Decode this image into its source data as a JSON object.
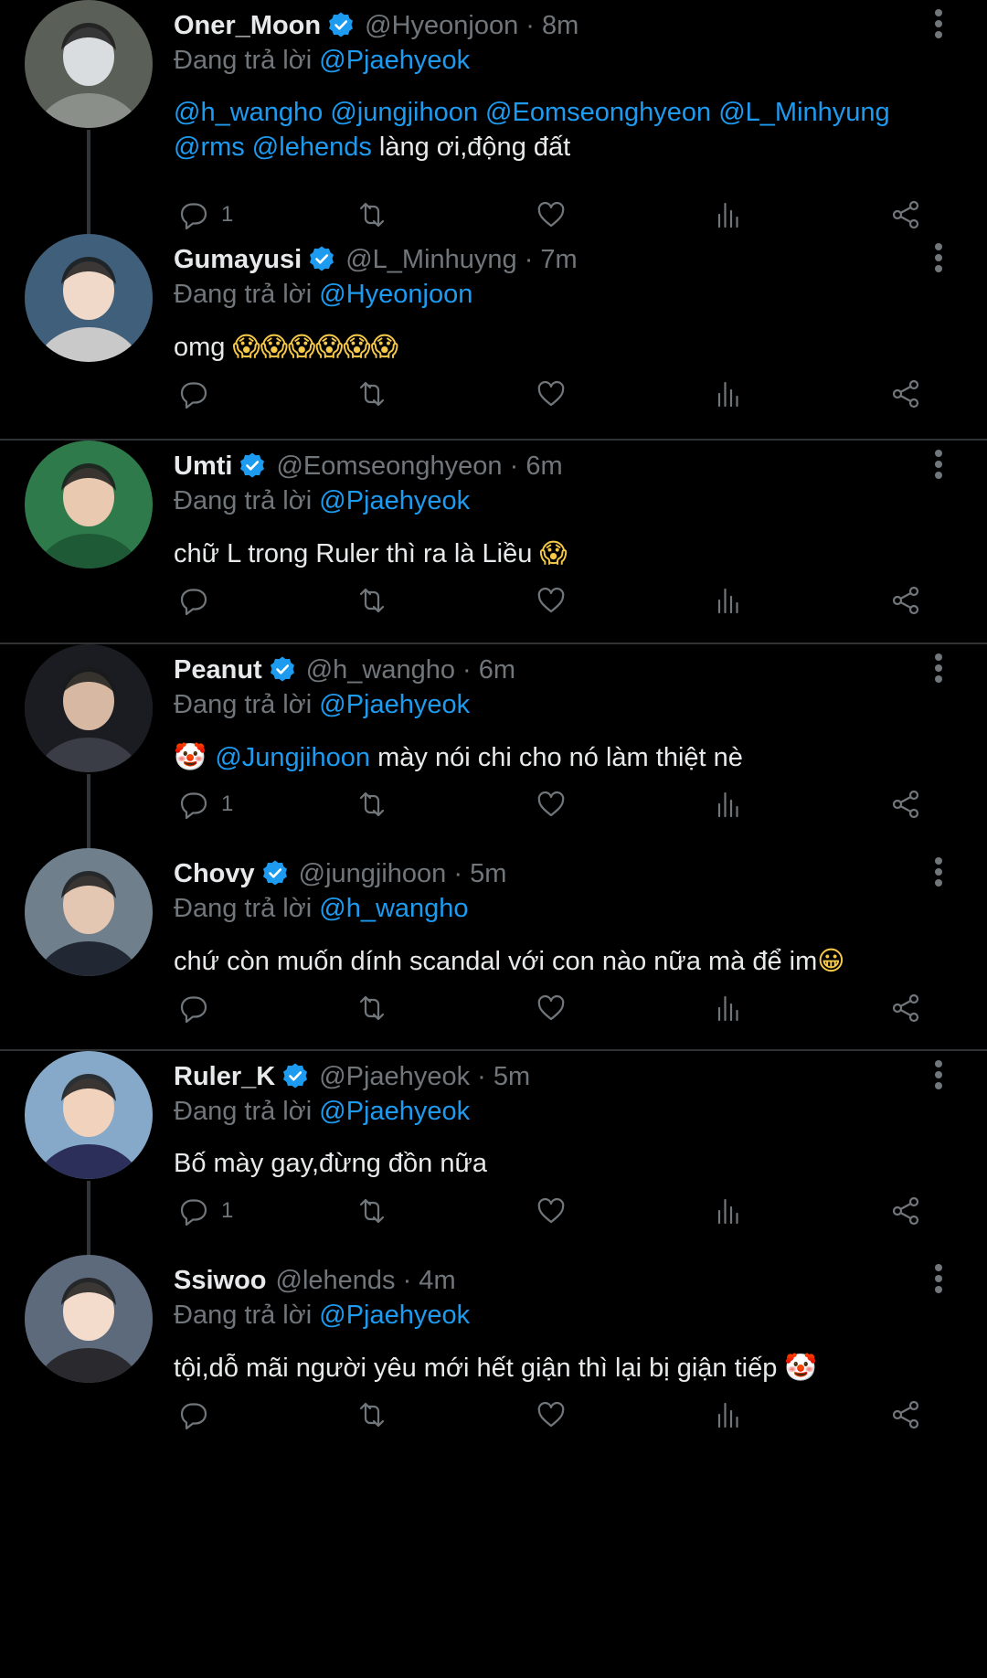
{
  "reply_prefix": "Đang trả lời",
  "colors": {
    "background": "#000000",
    "link": "#1d9bf0",
    "muted": "#71767b",
    "verified": "#1d9bf0"
  },
  "icons": {
    "reply": "comment-bubble-icon",
    "retweet": "retweet-icon",
    "like": "heart-icon",
    "views": "analytics-bars-icon",
    "share": "share-icon",
    "more": "more-vertical-icon",
    "verified": "verified-badge-icon"
  },
  "tweets": [
    {
      "name": "Oner_Moon",
      "verified": true,
      "handle_time": "@Hyeonjoon · 8m",
      "reply_to": "@Pjaehyeok",
      "text": [
        {
          "t": "@h_wangho @jungjihoon  @Eomseonghyeon @L_Minhyung @rms @lehends",
          "m": true
        },
        {
          "t": " làng ơi,động đất",
          "m": false
        }
      ],
      "reply_count": "1"
    },
    {
      "name": "Gumayusi",
      "verified": true,
      "handle_time": "@L_Minhuyng · 7m",
      "reply_to": "@Hyeonjoon",
      "text": [
        {
          "t": "omg ",
          "m": false
        },
        {
          "t": "😱😱😱😱😱😱",
          "m": false,
          "e": true
        }
      ],
      "reply_count": ""
    },
    {
      "name": "Umti",
      "verified": true,
      "handle_time": "@Eomseonghyeon · 6m",
      "reply_to": "@Pjaehyeok",
      "text": [
        {
          "t": "chữ L trong Ruler thì ra là Liều ",
          "m": false
        },
        {
          "t": "😱",
          "m": false,
          "e": true
        }
      ],
      "reply_count": ""
    },
    {
      "name": "Peanut",
      "verified": true,
      "handle_time": "@h_wangho · 6m",
      "reply_to": "@Pjaehyeok",
      "text": [
        {
          "t": "🤡 ",
          "m": false,
          "e": true
        },
        {
          "t": "@Jungjihoon",
          "m": true
        },
        {
          "t": " mày nói chi cho nó làm thiệt nè",
          "m": false
        }
      ],
      "reply_count": "1"
    },
    {
      "name": "Chovy",
      "verified": true,
      "handle_time": "@jungjihoon · 5m",
      "reply_to": "@h_wangho",
      "text": [
        {
          "t": "chứ còn muốn dính scandal với con nào nữa mà để im",
          "m": false
        },
        {
          "t": "😀",
          "m": false,
          "e": true
        }
      ],
      "reply_count": ""
    },
    {
      "name": "Ruler_K",
      "verified": true,
      "handle_time": "@Pjaehyeok · 5m",
      "reply_to": "@Pjaehyeok",
      "text": [
        {
          "t": "Bố mày gay,đừng đồn nữa",
          "m": false
        }
      ],
      "reply_count": "1"
    },
    {
      "name": "Ssiwoo",
      "verified": false,
      "handle_time": "@lehends · 4m",
      "reply_to": "@Pjaehyeok",
      "text": [
        {
          "t": "tội,dỗ mãi người yêu mới hết giận thì lại bị giận tiếp ",
          "m": false
        },
        {
          "t": "🤡",
          "m": false,
          "e": true
        }
      ],
      "reply_count": ""
    }
  ]
}
